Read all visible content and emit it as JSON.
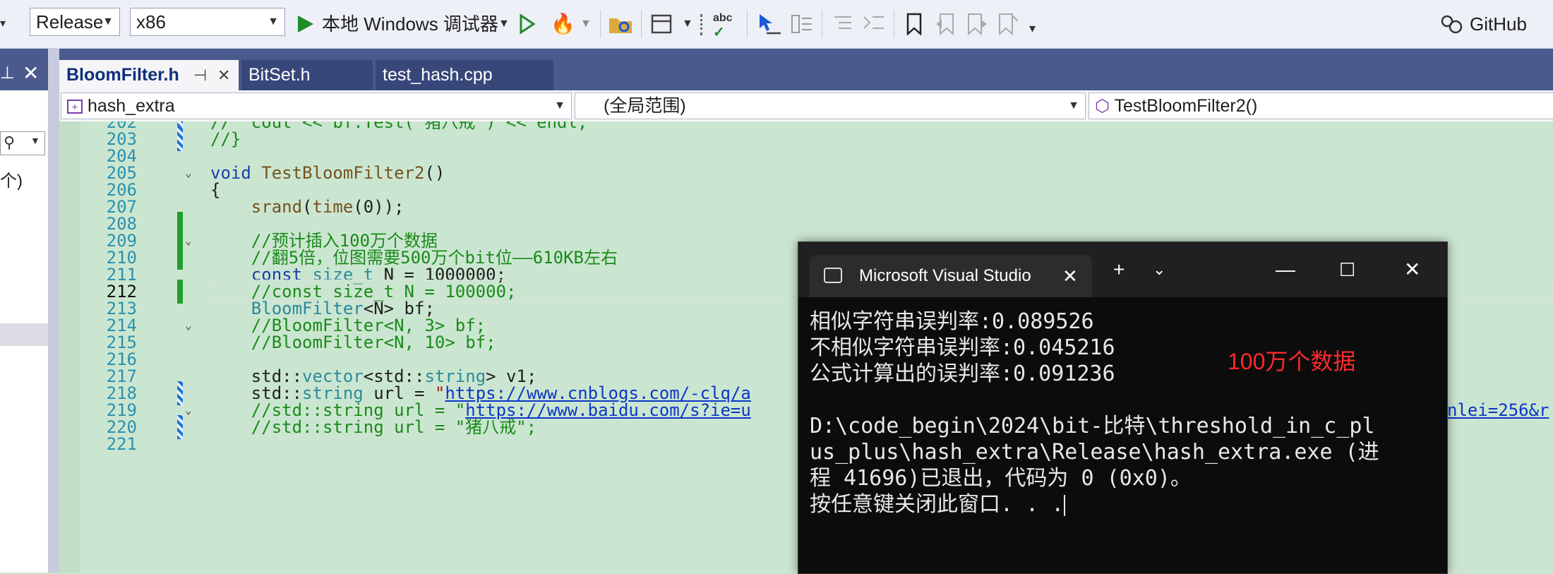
{
  "toolbar": {
    "config": "Release",
    "platform": "x86",
    "debugger": "本地 Windows 调试器",
    "github": "GitHub Co",
    "icons": [
      "play-icon",
      "play-outline-icon",
      "hot-reload-icon",
      "folder-icon",
      "window-layout-icon",
      "spellcheck-icon",
      "pointer-icon",
      "indent-icon",
      "comment-icon",
      "uncomment-icon",
      "bookmark-icon",
      "bookmark-prev-icon",
      "bookmark-next-icon",
      "bookmark-clear-icon",
      "overflow-icon",
      "github-icon"
    ]
  },
  "tabs": [
    {
      "label": "BloomFilter.h",
      "active": true
    },
    {
      "label": "BitSet.h",
      "active": false
    },
    {
      "label": "test_hash.cpp",
      "active": false
    }
  ],
  "left_panel": {
    "text": "个)"
  },
  "navbar": {
    "project": "hash_extra",
    "scope": "(全局范围)",
    "member": "TestBloomFilter2()"
  },
  "editor": {
    "current_line": "212",
    "lines": [
      {
        "num": "202",
        "code": "//  cout << bf.Test(\"猪八戒\") << endl;"
      },
      {
        "num": "203",
        "code": "//}"
      },
      {
        "num": "204",
        "code": ""
      },
      {
        "num": "205",
        "code": "void TestBloomFilter2()"
      },
      {
        "num": "206",
        "code": "{"
      },
      {
        "num": "207",
        "code": "    srand(time(0));"
      },
      {
        "num": "208",
        "code": ""
      },
      {
        "num": "209",
        "code": "    //预计插入100万个数据"
      },
      {
        "num": "210",
        "code": "    //翻5倍，位图需要500万个bit位——610KB左右"
      },
      {
        "num": "211",
        "code": "    const size_t N = 1000000;"
      },
      {
        "num": "212",
        "code": "    //const size_t N = 100000;"
      },
      {
        "num": "213",
        "code": "    BloomFilter<N> bf;"
      },
      {
        "num": "214",
        "code": "    //BloomFilter<N, 3> bf;"
      },
      {
        "num": "215",
        "code": "    //BloomFilter<N, 10> bf;"
      },
      {
        "num": "216",
        "code": ""
      },
      {
        "num": "217",
        "code": "    std::vector<std::string> v1;"
      },
      {
        "num": "218",
        "code": "    std::string url = \"https://www.cnblogs.com/-clq/a"
      },
      {
        "num": "219",
        "code": "    //std::string url = \"https://www.baidu.com/s?ie=u"
      },
      {
        "num": "220",
        "code": "    //std::string url = \"猪八戒\";"
      },
      {
        "num": "221",
        "code": ""
      }
    ],
    "line219_tail": "nlei=256&r"
  },
  "console": {
    "title": "Microsoft Visual Studio",
    "lines": [
      "相似字符串误判率:0.089526",
      "不相似字符串误判率:0.045216",
      "公式计算出的误判率:0.091236",
      "",
      "D:\\code_begin\\2024\\bit-比特\\threshold_in_c_pl",
      "us_plus\\hash_extra\\Release\\hash_extra.exe (进",
      "程 41696)已退出，代码为 0 (0x0)。",
      "按任意键关闭此窗口. . ."
    ],
    "annotation": "100万个数据"
  }
}
